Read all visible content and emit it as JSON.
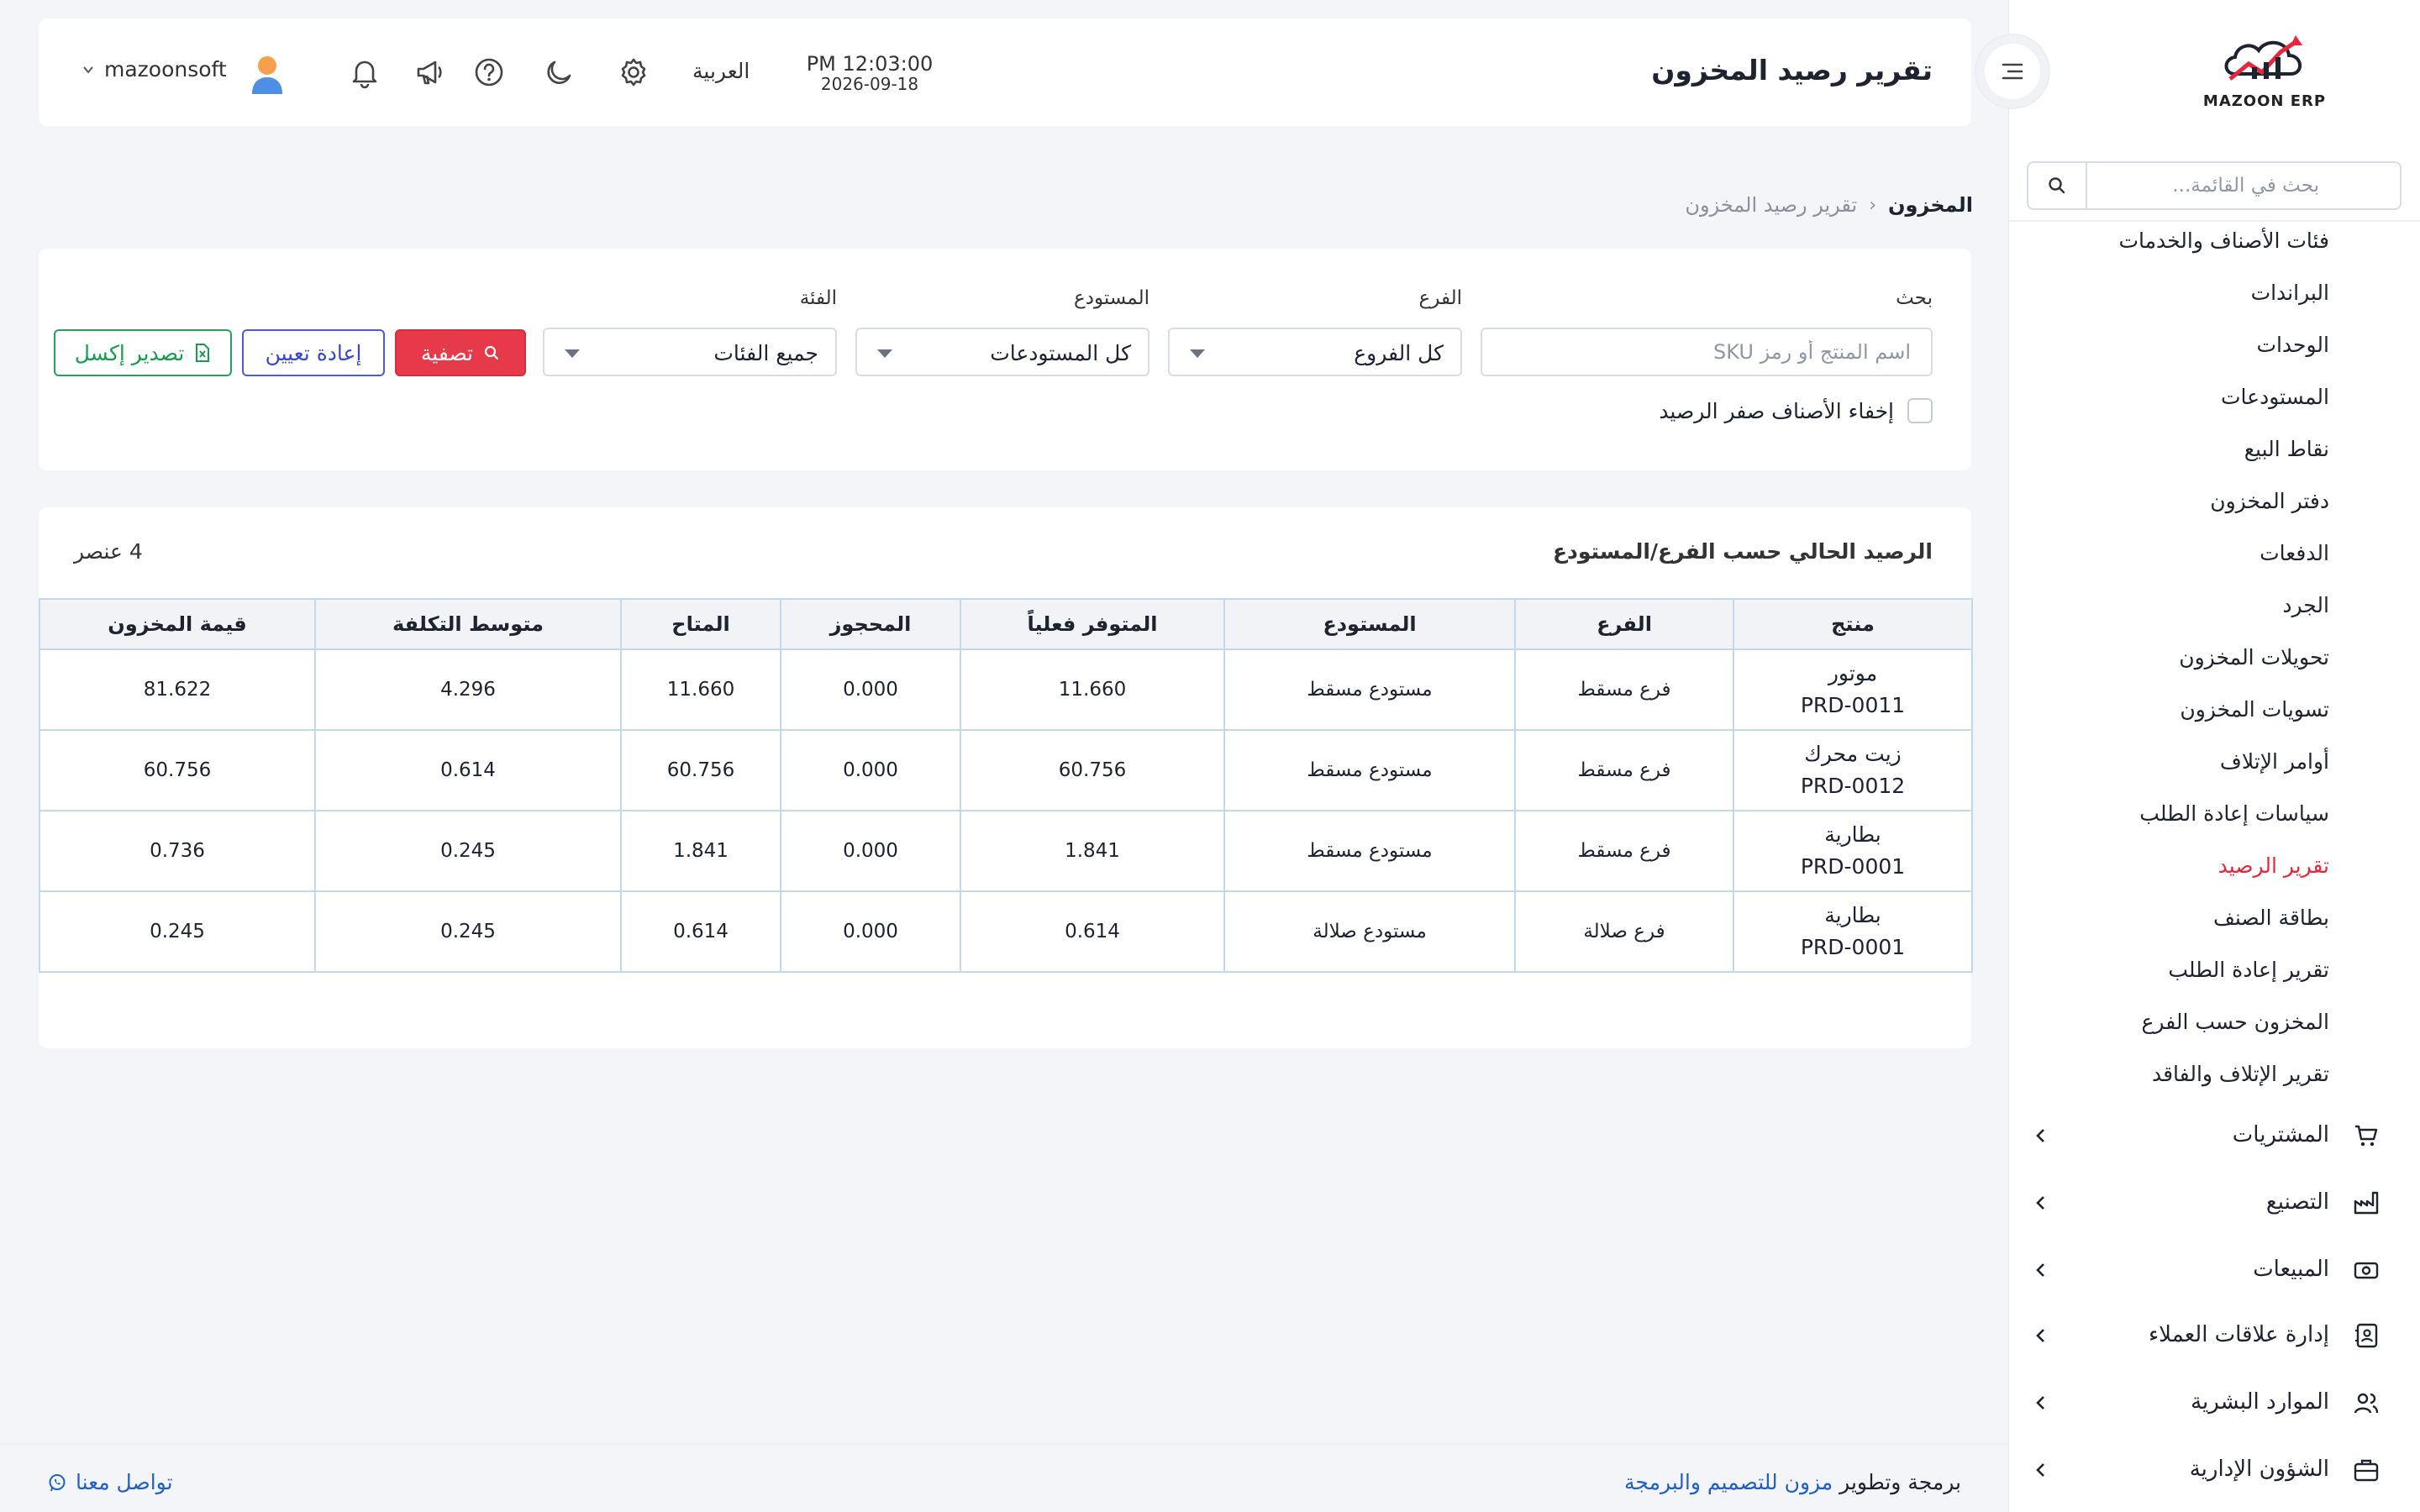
{
  "app": {
    "logo_text": "MAZOON ERP",
    "logo_colors": {
      "primary": "#e6273b",
      "secondary": "#1e2330"
    }
  },
  "sidebar": {
    "search_placeholder": "بحث في القائمة...",
    "items": [
      {
        "label": "فئات الأصناف والخدمات",
        "active": false
      },
      {
        "label": "البراندات",
        "active": false
      },
      {
        "label": "الوحدات",
        "active": false
      },
      {
        "label": "المستودعات",
        "active": false
      },
      {
        "label": "نقاط البيع",
        "active": false
      },
      {
        "label": "دفتر المخزون",
        "active": false
      },
      {
        "label": "الدفعات",
        "active": false
      },
      {
        "label": "الجرد",
        "active": false
      },
      {
        "label": "تحويلات المخزون",
        "active": false
      },
      {
        "label": "تسويات المخزون",
        "active": false
      },
      {
        "label": "أوامر الإتلاف",
        "active": false
      },
      {
        "label": "سياسات إعادة الطلب",
        "active": false
      },
      {
        "label": "تقرير الرصيد",
        "active": true
      },
      {
        "label": "بطاقة الصنف",
        "active": false
      },
      {
        "label": "تقرير إعادة الطلب",
        "active": false
      },
      {
        "label": "المخزون حسب الفرع",
        "active": false
      },
      {
        "label": "تقرير الإتلاف والفاقد",
        "active": false
      }
    ],
    "groups": [
      {
        "label": "المشتريات",
        "icon": "cart-icon"
      },
      {
        "label": "التصنيع",
        "icon": "factory-icon"
      },
      {
        "label": "المبيعات",
        "icon": "cash-icon"
      },
      {
        "label": "إدارة علاقات العملاء",
        "icon": "contacts-icon"
      },
      {
        "label": "الموارد البشرية",
        "icon": "users-icon"
      },
      {
        "label": "الشؤون الإدارية",
        "icon": "briefcase-icon"
      }
    ]
  },
  "header": {
    "title": "تقرير رصيد المخزون",
    "time": "PM 12:03:00",
    "date": "2026-09-18",
    "language": "العربية",
    "username": "mazoonsoft"
  },
  "breadcrumb": {
    "root": "المخزون",
    "current": "تقرير رصيد المخزون"
  },
  "filters": {
    "search_label": "بحث",
    "search_placeholder": "اسم المنتج أو رمز SKU",
    "branch_label": "الفرع",
    "branch_value": "كل الفروع",
    "warehouse_label": "المستودع",
    "warehouse_value": "كل المستودعات",
    "category_label": "الفئة",
    "category_value": "جميع الفئات",
    "filter_button": "تصفية",
    "reset_button": "إعادة تعيين",
    "export_button": "تصدير إكسل",
    "hide_zero_label": "إخفاء الأصناف صفر الرصيد",
    "hide_zero_checked": false
  },
  "table": {
    "title": "الرصيد الحالي حسب الفرع/المستودع",
    "count": "4 عنصر",
    "columns": [
      "منتج",
      "الفرع",
      "المستودع",
      "المتوفر فعلياً",
      "المحجوز",
      "المتاح",
      "متوسط التكلفة",
      "قيمة المخزون"
    ],
    "rows": [
      {
        "name": "موتور",
        "sku": "PRD-0011",
        "branch": "فرع مسقط",
        "warehouse": "مستودع مسقط",
        "on_hand": "11.660",
        "reserved": "0.000",
        "available": "11.660",
        "avg_cost": "4.296",
        "value": "81.622"
      },
      {
        "name": "زيت محرك",
        "sku": "PRD-0012",
        "branch": "فرع مسقط",
        "warehouse": "مستودع مسقط",
        "on_hand": "60.756",
        "reserved": "0.000",
        "available": "60.756",
        "avg_cost": "0.614",
        "value": "60.756"
      },
      {
        "name": "بطارية",
        "sku": "PRD-0001",
        "branch": "فرع مسقط",
        "warehouse": "مستودع مسقط",
        "on_hand": "1.841",
        "reserved": "0.000",
        "available": "1.841",
        "avg_cost": "0.245",
        "value": "0.736"
      },
      {
        "name": "بطارية",
        "sku": "PRD-0001",
        "branch": "فرع صلالة",
        "warehouse": "مستودع صلالة",
        "on_hand": "0.614",
        "reserved": "0.000",
        "available": "0.614",
        "avg_cost": "0.245",
        "value": "0.245"
      }
    ]
  },
  "footer": {
    "prefix": "برمجة وتطوير",
    "company_link": "مزون للتصميم والبرمجة",
    "contact": "تواصل معنا"
  },
  "colors": {
    "accent_red": "#e6394a",
    "reset_blue": "#3848c7",
    "export_green": "#1c9a4f",
    "link_blue": "#2160c4"
  }
}
